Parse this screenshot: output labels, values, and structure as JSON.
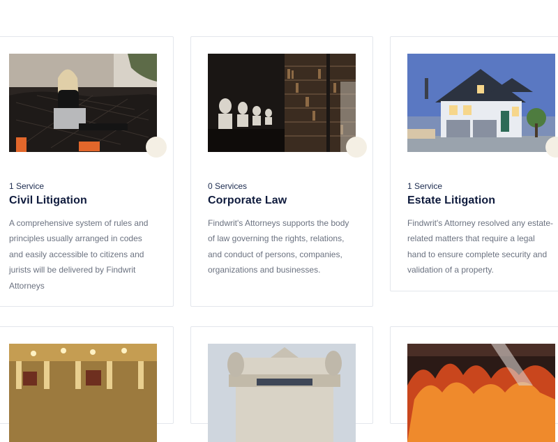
{
  "services": [
    {
      "count": "1 Service",
      "title": "Civil Litigation",
      "description": "A comprehensive system of rules and principles usually arranged in codes and easily accessible to citizens and jurists will be delivered by Findwrit Attorneys",
      "image_icon": "woman-with-laptop-on-sofa-image"
    },
    {
      "count": "0 Services",
      "title": "Corporate Law",
      "description": "Findwrit's Attorneys supports the body of law governing the rights, relations, and conduct of persons, companies, organizations and businesses.",
      "image_icon": "library-busts-bookshelves-image"
    },
    {
      "count": "1 Service",
      "title": "Estate Litigation",
      "description": "Findwrit's Attorney resolved any estate-related matters that require a legal hand to ensure complete security and validation of a property.",
      "image_icon": "house-at-dusk-image"
    },
    {
      "image_icon": "ornate-hall-image"
    },
    {
      "image_icon": "building-facade-statues-image"
    },
    {
      "image_icon": "fire-image"
    }
  ],
  "colors": {
    "title": "#0f1b3d",
    "text": "#6b7280",
    "border": "#e3e6ec",
    "bubble": "#f4efe4"
  }
}
